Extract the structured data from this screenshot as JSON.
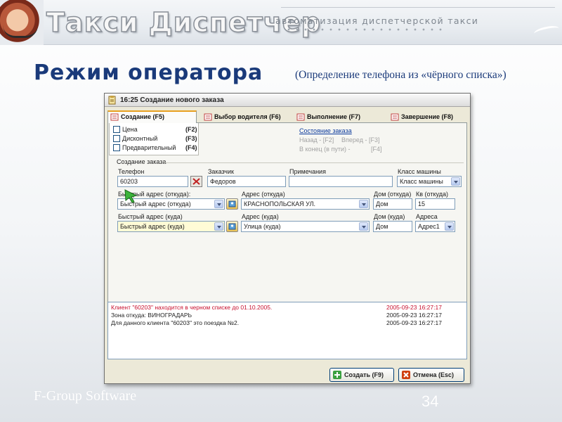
{
  "banner": {
    "title": "Такси Диспетчер",
    "subtitle": "автоматизация диспетчерской такси"
  },
  "slide": {
    "mode_title": "Режим оператора",
    "mode_note": "(Определение телефона из «чёрного списка»)",
    "footer_company": "F-Group Software",
    "page_number": "34"
  },
  "window": {
    "title": "16:25 Создание нового заказа",
    "tabs": [
      {
        "label": "Создание (F5)",
        "active": true
      },
      {
        "label": "Выбор водителя (F6)",
        "active": false
      },
      {
        "label": "Выполнение (F7)",
        "active": false
      },
      {
        "label": "Завершение (F8)",
        "active": false
      }
    ],
    "options": [
      {
        "label": "Цена",
        "key": "(F2)"
      },
      {
        "label": "Дисконтный",
        "key": "(F3)"
      },
      {
        "label": "Предварительный",
        "key": "(F4)"
      }
    ],
    "order_state_link": "Состояние заказа",
    "nav_hints": {
      "back": "Назад - [F2]",
      "forward": "Вперед - [F3]",
      "to_end": "В конец (в пути) -",
      "to_end_key": "[F4]"
    },
    "group_title": "Создание заказа",
    "fields": {
      "phone_label": "Телефон",
      "phone_value": "60203",
      "customer_label": "Заказчик",
      "customer_value": "Федоров",
      "notes_label": "Примечания",
      "notes_value": "",
      "car_class_label": "Класс машины",
      "car_class_value": "Класс машины",
      "quick_from_label": "Быстрый адрес (откуда):",
      "quick_from_value": "Быстрый адрес (откуда)",
      "addr_from_label": "Адрес (откуда)",
      "addr_from_value": "КРАСНОПОЛЬСКАЯ УЛ.",
      "house_from_label": "Дом (откуда)",
      "house_from_value": "Дом",
      "flat_from_label": "Кв (откуда)",
      "flat_from_value": "15",
      "quick_to_label": "Быстрый адрес (куда)",
      "quick_to_value": "Быстрый адрес (куда)",
      "addr_to_label": "Адрес (куда)",
      "addr_to_value": "Улица (куда)",
      "house_to_label": "Дом (куда)",
      "house_to_value": "Дом",
      "addresses_label": "Адреса",
      "addresses_value": "Адрес1"
    },
    "log": [
      {
        "text": "Клиент \"60203\" находится в черном списке до 01.10.2005.",
        "time": "2005-09-23 16:27:17",
        "alert": true
      },
      {
        "text": "Зона откуда: ВИНОГРАДАРЬ",
        "time": "2005-09-23 16:27:17",
        "alert": false
      },
      {
        "text": "Для данного клиента \"60203\" это поездка №2.",
        "time": "2005-09-23 16:27:17",
        "alert": false
      }
    ],
    "buttons": {
      "create": "Создать (F9)",
      "cancel": "Отмена (Esc)"
    },
    "colors": {
      "alert": "#c8102e",
      "link": "#0b3a9c",
      "heading": "#1a3a7a"
    }
  }
}
